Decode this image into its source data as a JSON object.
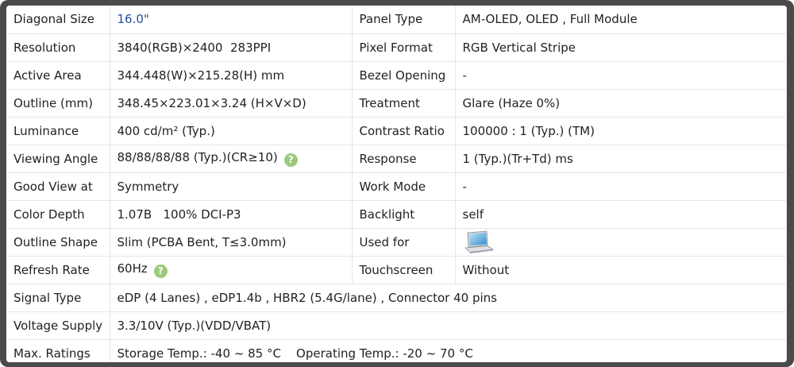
{
  "rows": [
    {
      "label": "Diagonal Size",
      "value": "16.0\"",
      "label2": "Panel Type",
      "value2": "AM-OLED, OLED , Full Module"
    },
    {
      "label": "Resolution",
      "value": "3840(RGB)×2400  283PPI",
      "label2": "Pixel Format",
      "value2": "RGB Vertical Stripe"
    },
    {
      "label": "Active Area",
      "value": "344.448(W)×215.28(H) mm",
      "label2": "Bezel Opening",
      "value2": "-"
    },
    {
      "label": "Outline (mm)",
      "value": "348.45×223.01×3.24 (H×V×D)",
      "label2": "Treatment",
      "value2": "Glare (Haze 0%)"
    },
    {
      "label": "Luminance",
      "value": "400 cd/m² (Typ.)",
      "label2": "Contrast Ratio",
      "value2": "100000 : 1 (Typ.) (TM)"
    },
    {
      "label": "Viewing Angle",
      "value": "88/88/88/88 (Typ.)(CR≥10)",
      "label2": "Response",
      "value2": "1 (Typ.)(Tr+Td) ms"
    },
    {
      "label": "Good View at",
      "value": "Symmetry",
      "label2": "Work Mode",
      "value2": "-"
    },
    {
      "label": "Color Depth",
      "value": "1.07B   100% DCI-P3",
      "label2": "Backlight",
      "value2": "self"
    },
    {
      "label": "Outline Shape",
      "value": "Slim (PCBA Bent, T≤3.0mm)",
      "label2": "Used for",
      "value2_icon": "laptop-icon"
    },
    {
      "label": "Refresh Rate",
      "value": "60Hz",
      "label2": "Touchscreen",
      "value2": "Without"
    },
    {
      "label": "Signal Type",
      "value": "eDP (4 Lanes) , eDP1.4b , HBR2 (5.4G/lane) , Connector 40 pins"
    },
    {
      "label": "Voltage Supply",
      "value": "3.3/10V (Typ.)(VDD/VBAT)"
    },
    {
      "label": "Max. Ratings",
      "value": "Storage Temp.: -40 ~ 85 °C    Operating Temp.: -20 ~ 70 °C"
    }
  ],
  "help_icon": "?",
  "colors": {
    "frame": "#4a4a4a",
    "accent_value": "#1c4f9c",
    "help_badge": "#9cc97a"
  }
}
